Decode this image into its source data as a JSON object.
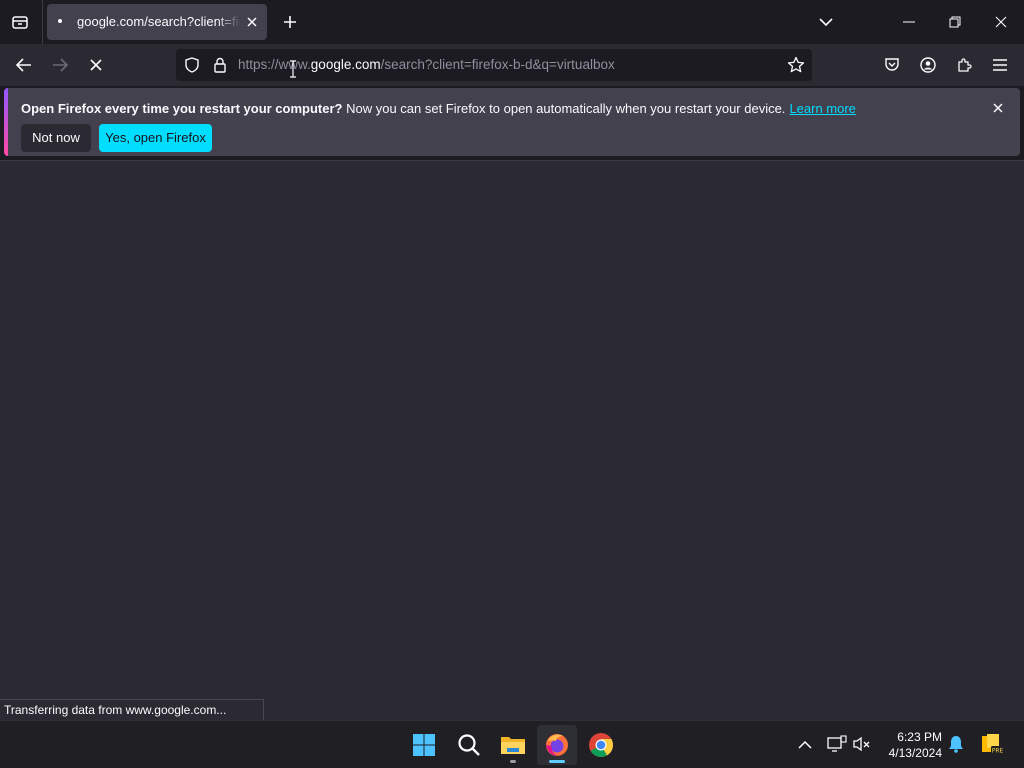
{
  "tabs": [
    {
      "title": "google.com/search?client=firefox-b-d&q=virtualbox"
    }
  ],
  "urlbar": {
    "scheme": "https://",
    "prefix": "www.",
    "host": "google.com",
    "path": "/search?client=firefox-b-d&q=virtualbox"
  },
  "notification": {
    "bold_text": "Open Firefox every time you restart your computer?",
    "text": " Now you can set Firefox to open automatically when you restart your device.",
    "link": "Learn more",
    "secondary_button": "Not now",
    "primary_button": "Yes, open Firefox"
  },
  "status_text": "Transferring data from www.google.com...",
  "taskbar": {
    "time": "6:23 PM",
    "date": "4/13/2024",
    "apps": [
      "start",
      "search",
      "file-explorer",
      "firefox",
      "chrome"
    ]
  },
  "colors": {
    "accent": "#00ddff",
    "chrome_bg": "#2b2a33",
    "tab_bg": "#42414d",
    "firefox_indicator": "#60cdff"
  }
}
